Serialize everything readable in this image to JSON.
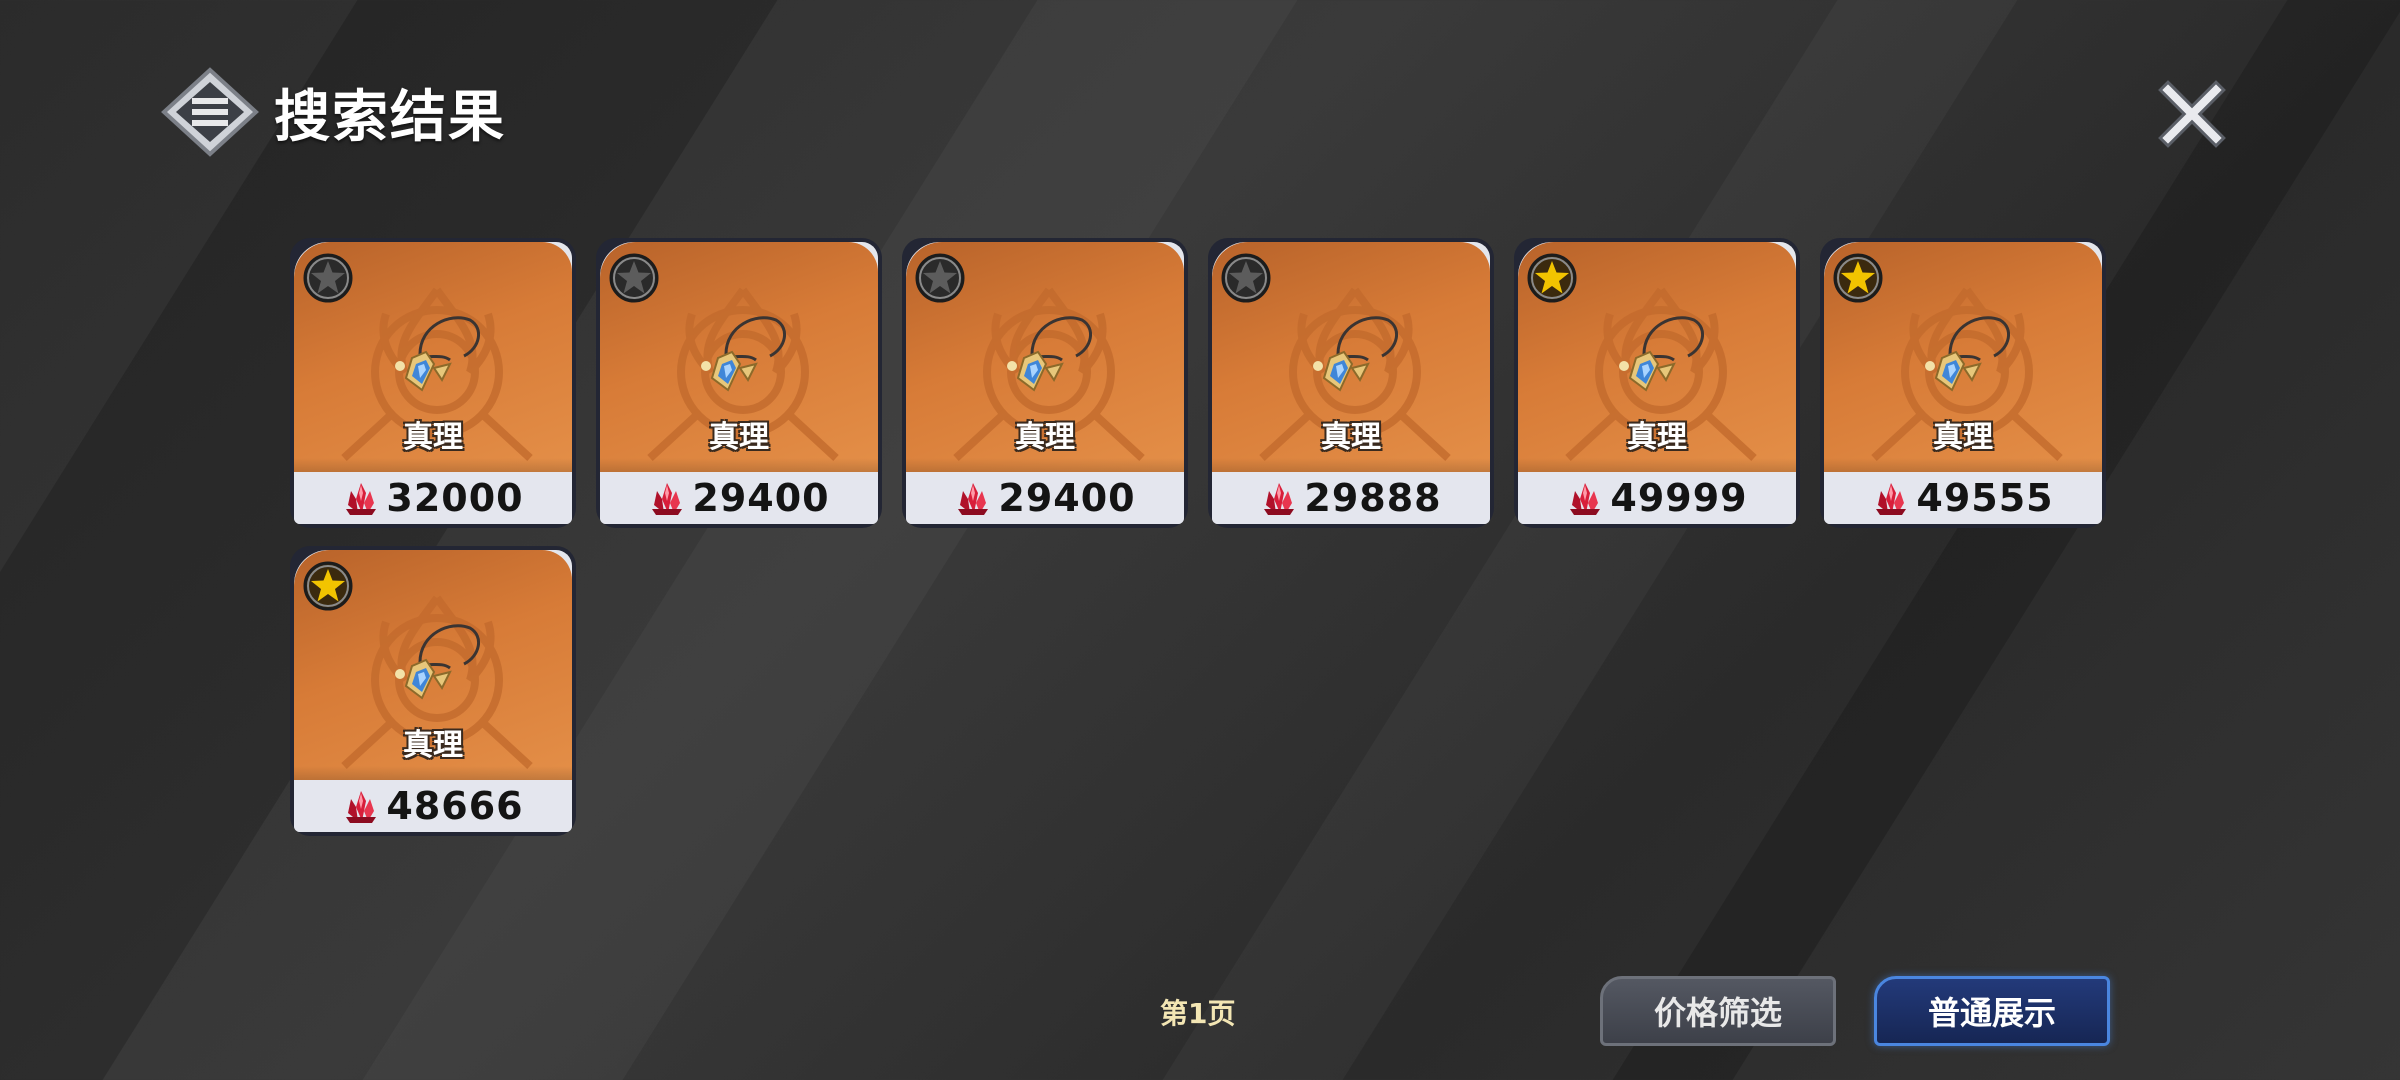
{
  "header": {
    "title": "搜索结果"
  },
  "items": [
    {
      "name": "真理",
      "price": "32000",
      "starred": false
    },
    {
      "name": "真理",
      "price": "29400",
      "starred": false
    },
    {
      "name": "真理",
      "price": "29400",
      "starred": false
    },
    {
      "name": "真理",
      "price": "29888",
      "starred": false
    },
    {
      "name": "真理",
      "price": "49999",
      "starred": true
    },
    {
      "name": "真理",
      "price": "49555",
      "starred": true
    },
    {
      "name": "真理",
      "price": "48666",
      "starred": true
    }
  ],
  "footer": {
    "page_label": "第1页",
    "filter_label": "价格筛选",
    "display_label": "普通展示"
  },
  "colors": {
    "card_orange": "#d77b37",
    "star_gold": "#f2c400",
    "star_inactive": "#3a3a3a",
    "accent_blue": "#4a86e0",
    "crystal_red": "#d81e3a"
  },
  "icons": {
    "header": "menu-diamond-icon",
    "close": "close-icon",
    "star": "star-icon",
    "currency": "crystal-icon",
    "item": "pendant-necklace-icon"
  }
}
